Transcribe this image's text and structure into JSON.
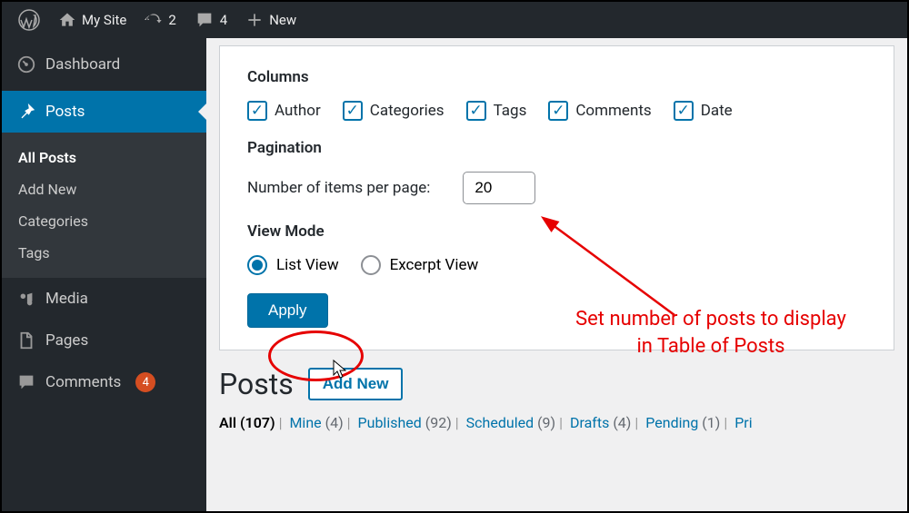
{
  "toolbar": {
    "site_name": "My Site",
    "updates_count": "2",
    "comments_count": "4",
    "new_label": "New"
  },
  "sidebar": {
    "dashboard": "Dashboard",
    "posts": "Posts",
    "posts_sub": {
      "all": "All Posts",
      "add": "Add New",
      "categories": "Categories",
      "tags": "Tags"
    },
    "media": "Media",
    "pages": "Pages",
    "comments": "Comments",
    "comments_badge": "4"
  },
  "screen_options": {
    "columns_heading": "Columns",
    "columns": {
      "author": "Author",
      "categories": "Categories",
      "tags": "Tags",
      "comments": "Comments",
      "date": "Date"
    },
    "pagination_heading": "Pagination",
    "items_label": "Number of items per page:",
    "items_value": "20",
    "view_mode_heading": "View Mode",
    "view_list": "List View",
    "view_excerpt": "Excerpt View",
    "apply_label": "Apply"
  },
  "annotation": "Set number of posts to display in Table of Posts",
  "page": {
    "title": "Posts",
    "add_new": "Add New"
  },
  "filters": {
    "all": {
      "label": "All",
      "count": "(107)"
    },
    "mine": {
      "label": "Mine",
      "count": "(4)"
    },
    "published": {
      "label": "Published",
      "count": "(92)"
    },
    "scheduled": {
      "label": "Scheduled",
      "count": "(9)"
    },
    "drafts": {
      "label": "Drafts",
      "count": "(4)"
    },
    "pending": {
      "label": "Pending",
      "count": "(1)"
    },
    "private": {
      "label": "Pri"
    }
  }
}
